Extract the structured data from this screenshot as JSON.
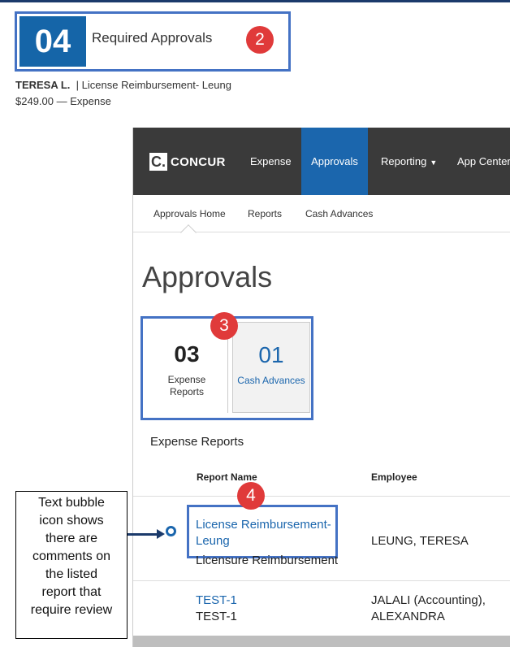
{
  "summary_tile": {
    "count": "04",
    "title": "Required Approvals",
    "badge": "2",
    "employee": "TERESA L.",
    "separator": "|",
    "report": "License Reimbursement- Leung",
    "amount_line": "$249.00 — Expense"
  },
  "app": {
    "logo_mark": "C.",
    "logo_text": "CONCUR",
    "nav": {
      "expense": "Expense",
      "approvals": "Approvals",
      "reporting": "Reporting",
      "app_center": "App Center"
    },
    "subnav": {
      "home": "Approvals Home",
      "reports": "Reports",
      "cash": "Cash Advances"
    },
    "page_title": "Approvals",
    "tiles": [
      {
        "count": "03",
        "label_line1": "Expense",
        "label_line2": "Reports"
      },
      {
        "count": "01",
        "label_line1": "Cash Advances",
        "label_line2": ""
      }
    ],
    "badge_3": "3",
    "section_title": "Expense Reports",
    "columns": {
      "report_name": "Report Name",
      "employee": "Employee"
    },
    "badge_4": "4",
    "rows": [
      {
        "name_line1": "License Reimbursement-",
        "name_line2": "Leung",
        "sub": "Licensure Reimbursement",
        "employee": "LEUNG, TERESA"
      },
      {
        "name_line1": "TEST-1",
        "sub": "TEST-1",
        "employee_line1": "JALALI (Accounting),",
        "employee_line2": "ALEXANDRA"
      }
    ]
  },
  "callout": {
    "text_lines": [
      "Text bubble",
      "icon shows",
      "there are",
      "comments on",
      "the listed",
      "report that",
      "require review"
    ]
  },
  "colors": {
    "concur_blue": "#1b66ad",
    "highlight": "#4472c4",
    "badge_red": "#e03a3a",
    "navbar": "#3a3a3a"
  }
}
